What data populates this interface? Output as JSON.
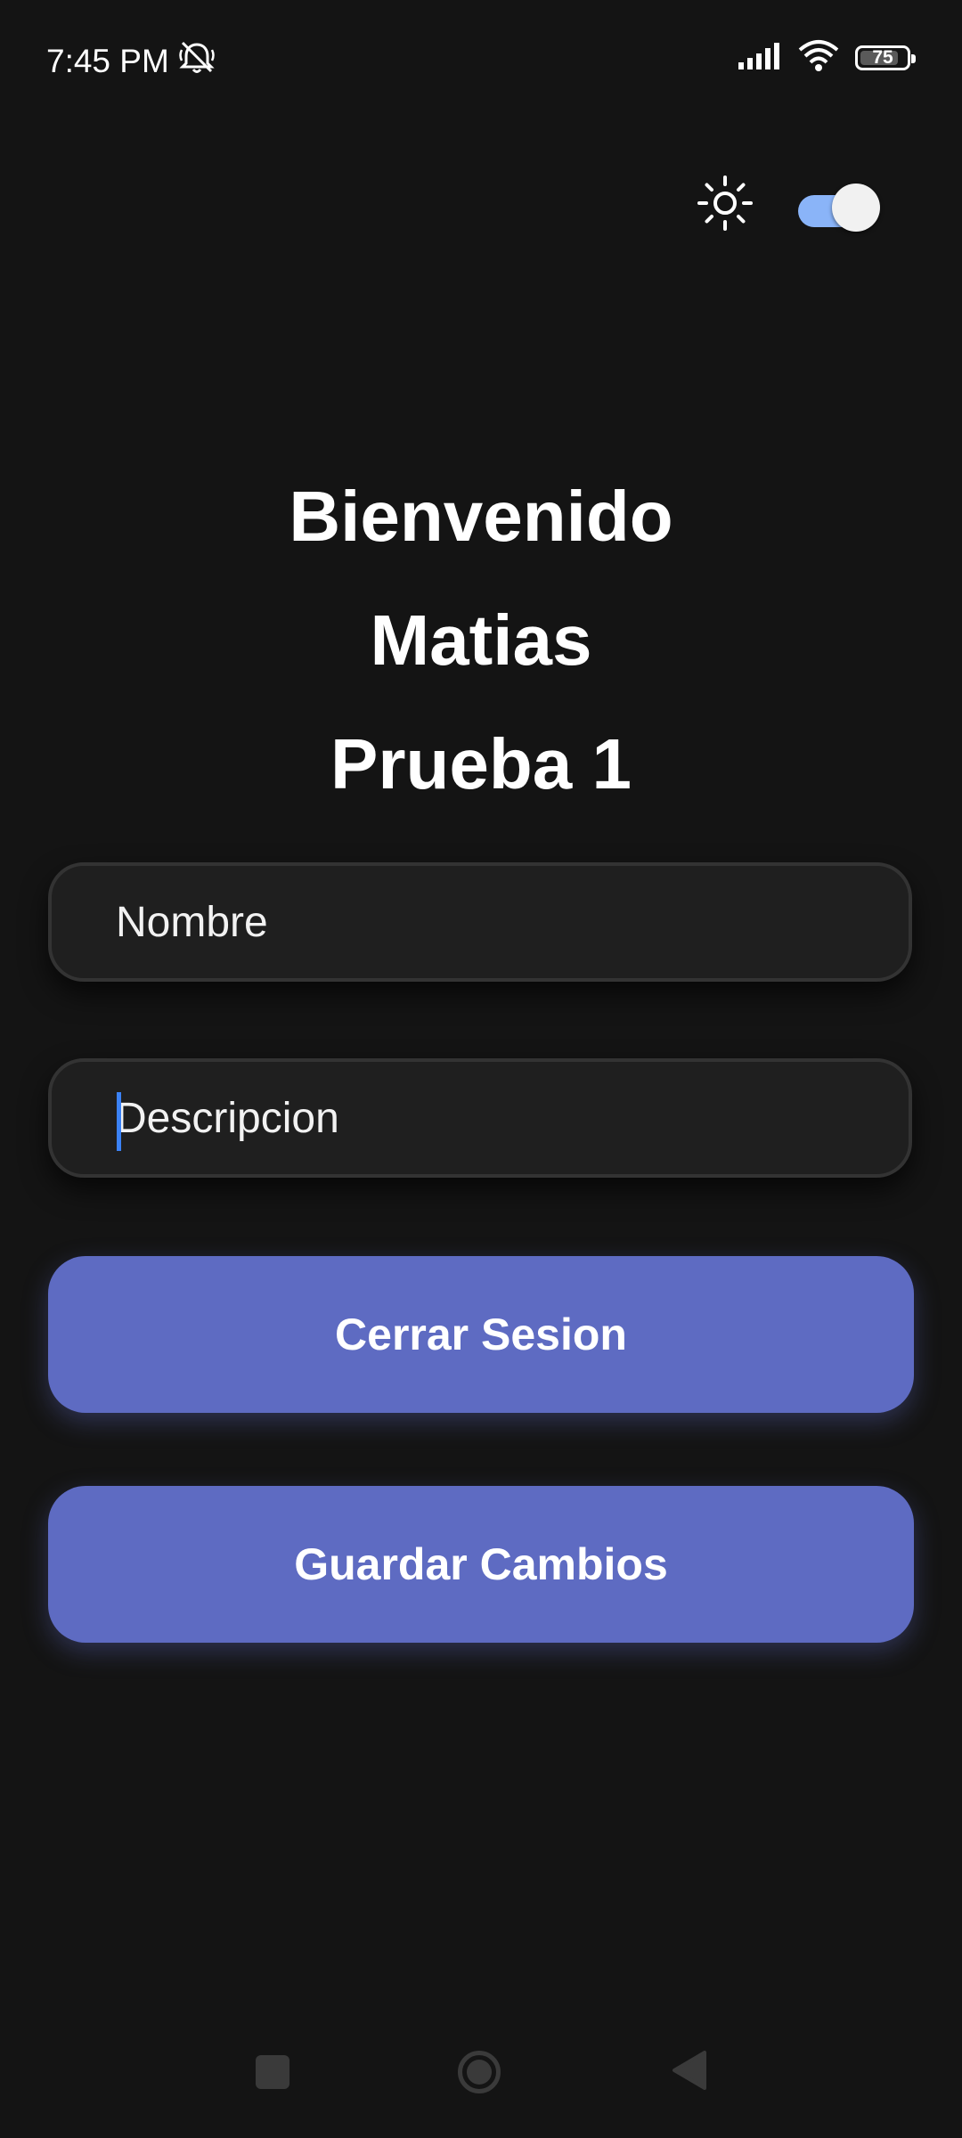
{
  "status_bar": {
    "time": "7:45 PM",
    "battery_level": "75",
    "icons": [
      "bell-off-icon",
      "signal-icon",
      "wifi-icon",
      "battery-icon"
    ]
  },
  "theme": {
    "icon": "sun-icon",
    "dark_mode_enabled": true,
    "switch_track_color": "#8ab4f8"
  },
  "greeting": {
    "line1": "Bienvenido",
    "line2": "Matias",
    "line3": "Prueba 1"
  },
  "form": {
    "nombre": {
      "value": "",
      "placeholder": "Nombre"
    },
    "descripcion": {
      "value": "",
      "placeholder": "Descripcion",
      "focused": true
    }
  },
  "buttons": {
    "logout_label": "Cerrar Sesion",
    "save_label": "Guardar Cambios",
    "color": "#5e6bc2"
  },
  "nav_bar": {
    "items": [
      "recents-icon",
      "home-icon",
      "back-icon"
    ]
  }
}
